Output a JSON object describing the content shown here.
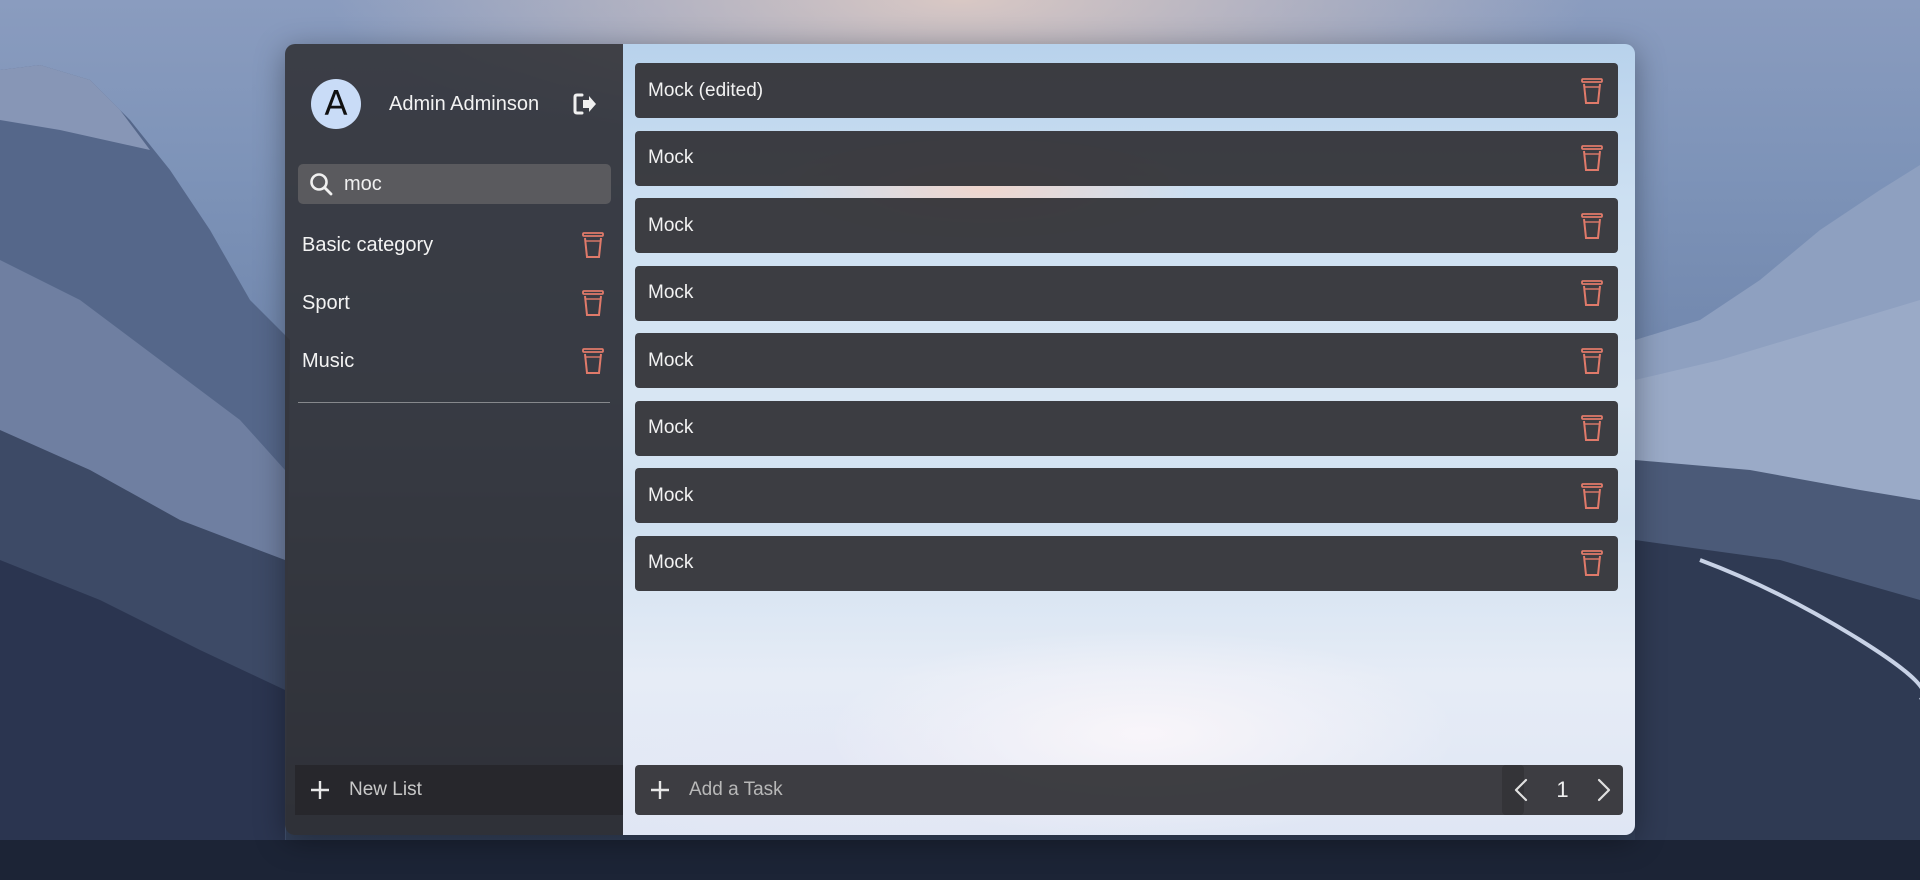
{
  "profile": {
    "avatar_letter": "A",
    "name": "Admin Adminson"
  },
  "search": {
    "value": "moc",
    "placeholder": ""
  },
  "sidebar": {
    "categories": [
      {
        "label": "Basic category"
      },
      {
        "label": "Sport"
      },
      {
        "label": "Music"
      }
    ],
    "new_list_label": "New List"
  },
  "tasks": [
    {
      "label": "Mock (edited)"
    },
    {
      "label": "Mock"
    },
    {
      "label": "Mock"
    },
    {
      "label": "Mock"
    },
    {
      "label": "Mock"
    },
    {
      "label": "Mock"
    },
    {
      "label": "Mock"
    },
    {
      "label": "Mock"
    }
  ],
  "add_task": {
    "placeholder": "Add a Task",
    "value": ""
  },
  "pagination": {
    "current_page": "1"
  },
  "colors": {
    "trash_icon": "#e07a6a",
    "avatar_bg": "#c9dcf7"
  },
  "icons": {
    "logout": "logout-icon",
    "search": "search-icon",
    "delete": "trash-icon",
    "add": "plus-icon",
    "prev": "chevron-left-icon",
    "next": "chevron-right-icon"
  }
}
